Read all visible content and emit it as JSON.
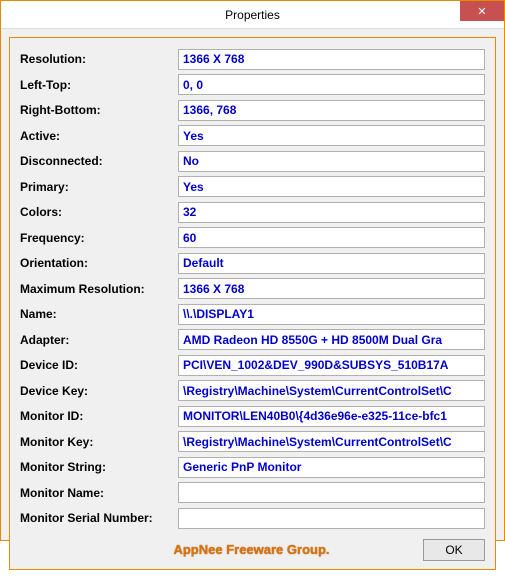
{
  "window": {
    "title": "Properties",
    "close_glyph": "✕"
  },
  "rows": [
    {
      "label": "Resolution:",
      "value": "1366 X 768"
    },
    {
      "label": "Left-Top:",
      "value": "0, 0"
    },
    {
      "label": "Right-Bottom:",
      "value": "1366, 768"
    },
    {
      "label": "Active:",
      "value": "Yes"
    },
    {
      "label": "Disconnected:",
      "value": "No"
    },
    {
      "label": "Primary:",
      "value": "Yes"
    },
    {
      "label": "Colors:",
      "value": "32"
    },
    {
      "label": "Frequency:",
      "value": "60"
    },
    {
      "label": "Orientation:",
      "value": "Default"
    },
    {
      "label": "Maximum Resolution:",
      "value": "1366 X 768"
    },
    {
      "label": "Name:",
      "value": "\\\\.\\DISPLAY1"
    },
    {
      "label": "Adapter:",
      "value": "AMD Radeon HD 8550G + HD 8500M Dual Gra"
    },
    {
      "label": "Device ID:",
      "value": "PCI\\VEN_1002&DEV_990D&SUBSYS_510B17A"
    },
    {
      "label": "Device Key:",
      "value": "\\Registry\\Machine\\System\\CurrentControlSet\\C"
    },
    {
      "label": "Monitor ID:",
      "value": "MONITOR\\LEN40B0\\{4d36e96e-e325-11ce-bfc1"
    },
    {
      "label": "Monitor Key:",
      "value": "\\Registry\\Machine\\System\\CurrentControlSet\\C"
    },
    {
      "label": "Monitor String:",
      "value": "Generic PnP Monitor"
    },
    {
      "label": "Monitor Name:",
      "value": ""
    },
    {
      "label": "Monitor Serial Number:",
      "value": ""
    }
  ],
  "footer": {
    "branding": "AppNee Freeware Group.",
    "ok_label": "OK"
  }
}
